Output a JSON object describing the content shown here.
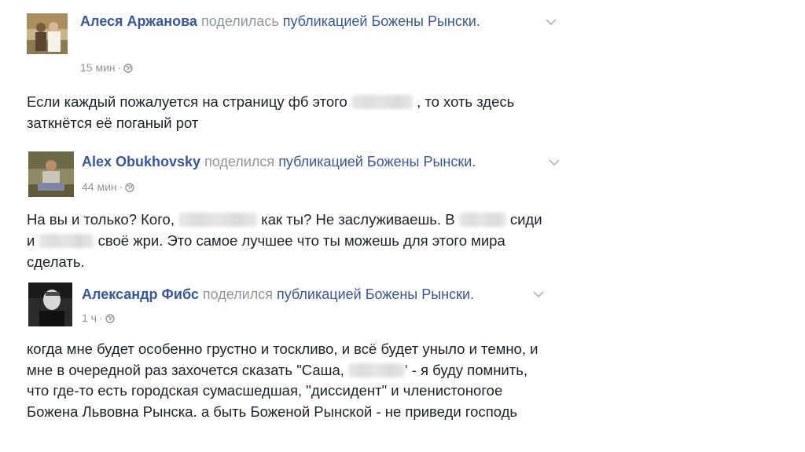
{
  "posts": [
    {
      "author": "Алеся Аржанова",
      "shared_verb": "поделилась",
      "shared_link": "публикацией Божены Рынски.",
      "time": "15 мин",
      "dot": "·",
      "text_before": "Если каждый пожалуется на страницу фб этого",
      "text_after": ", то хоть здесь заткнётся её поганый рот"
    },
    {
      "author": "Alex Obukhovsky",
      "shared_verb": "поделился",
      "shared_link": "публикацией Божены Рынски.",
      "time": "44 мин",
      "dot": "·",
      "text_part1": "На вы и только? Кого,",
      "text_part2": "как ты? Не заслуживаешь. В",
      "text_part3": "сиди и",
      "text_part4": "своё жри. Это самое лучшее что ты можешь для этого мира сделать."
    },
    {
      "author": "Александр Фибс",
      "shared_verb": "поделился",
      "shared_link": "публикацией Божены Рынски.",
      "time": "1 ч",
      "dot": "·",
      "text_before": "когда мне будет особенно грустно и тоскливо, и всё будет уныло и темно, и мне в очередной раз захочется сказать \"Саша,",
      "text_after": "' - я буду помнить, что где-то есть городская сумасшедшая, \"диссидент\" и членистоногое Божена Львовна Рынска. а быть Боженой Рынской - не приведи господь"
    }
  ],
  "icons": {
    "globe": "globe-icon",
    "chevron": "chevron-down-icon"
  },
  "colors": {
    "link_blue": "#365899",
    "meta_gray": "#90949c",
    "text": "#1d2129"
  }
}
